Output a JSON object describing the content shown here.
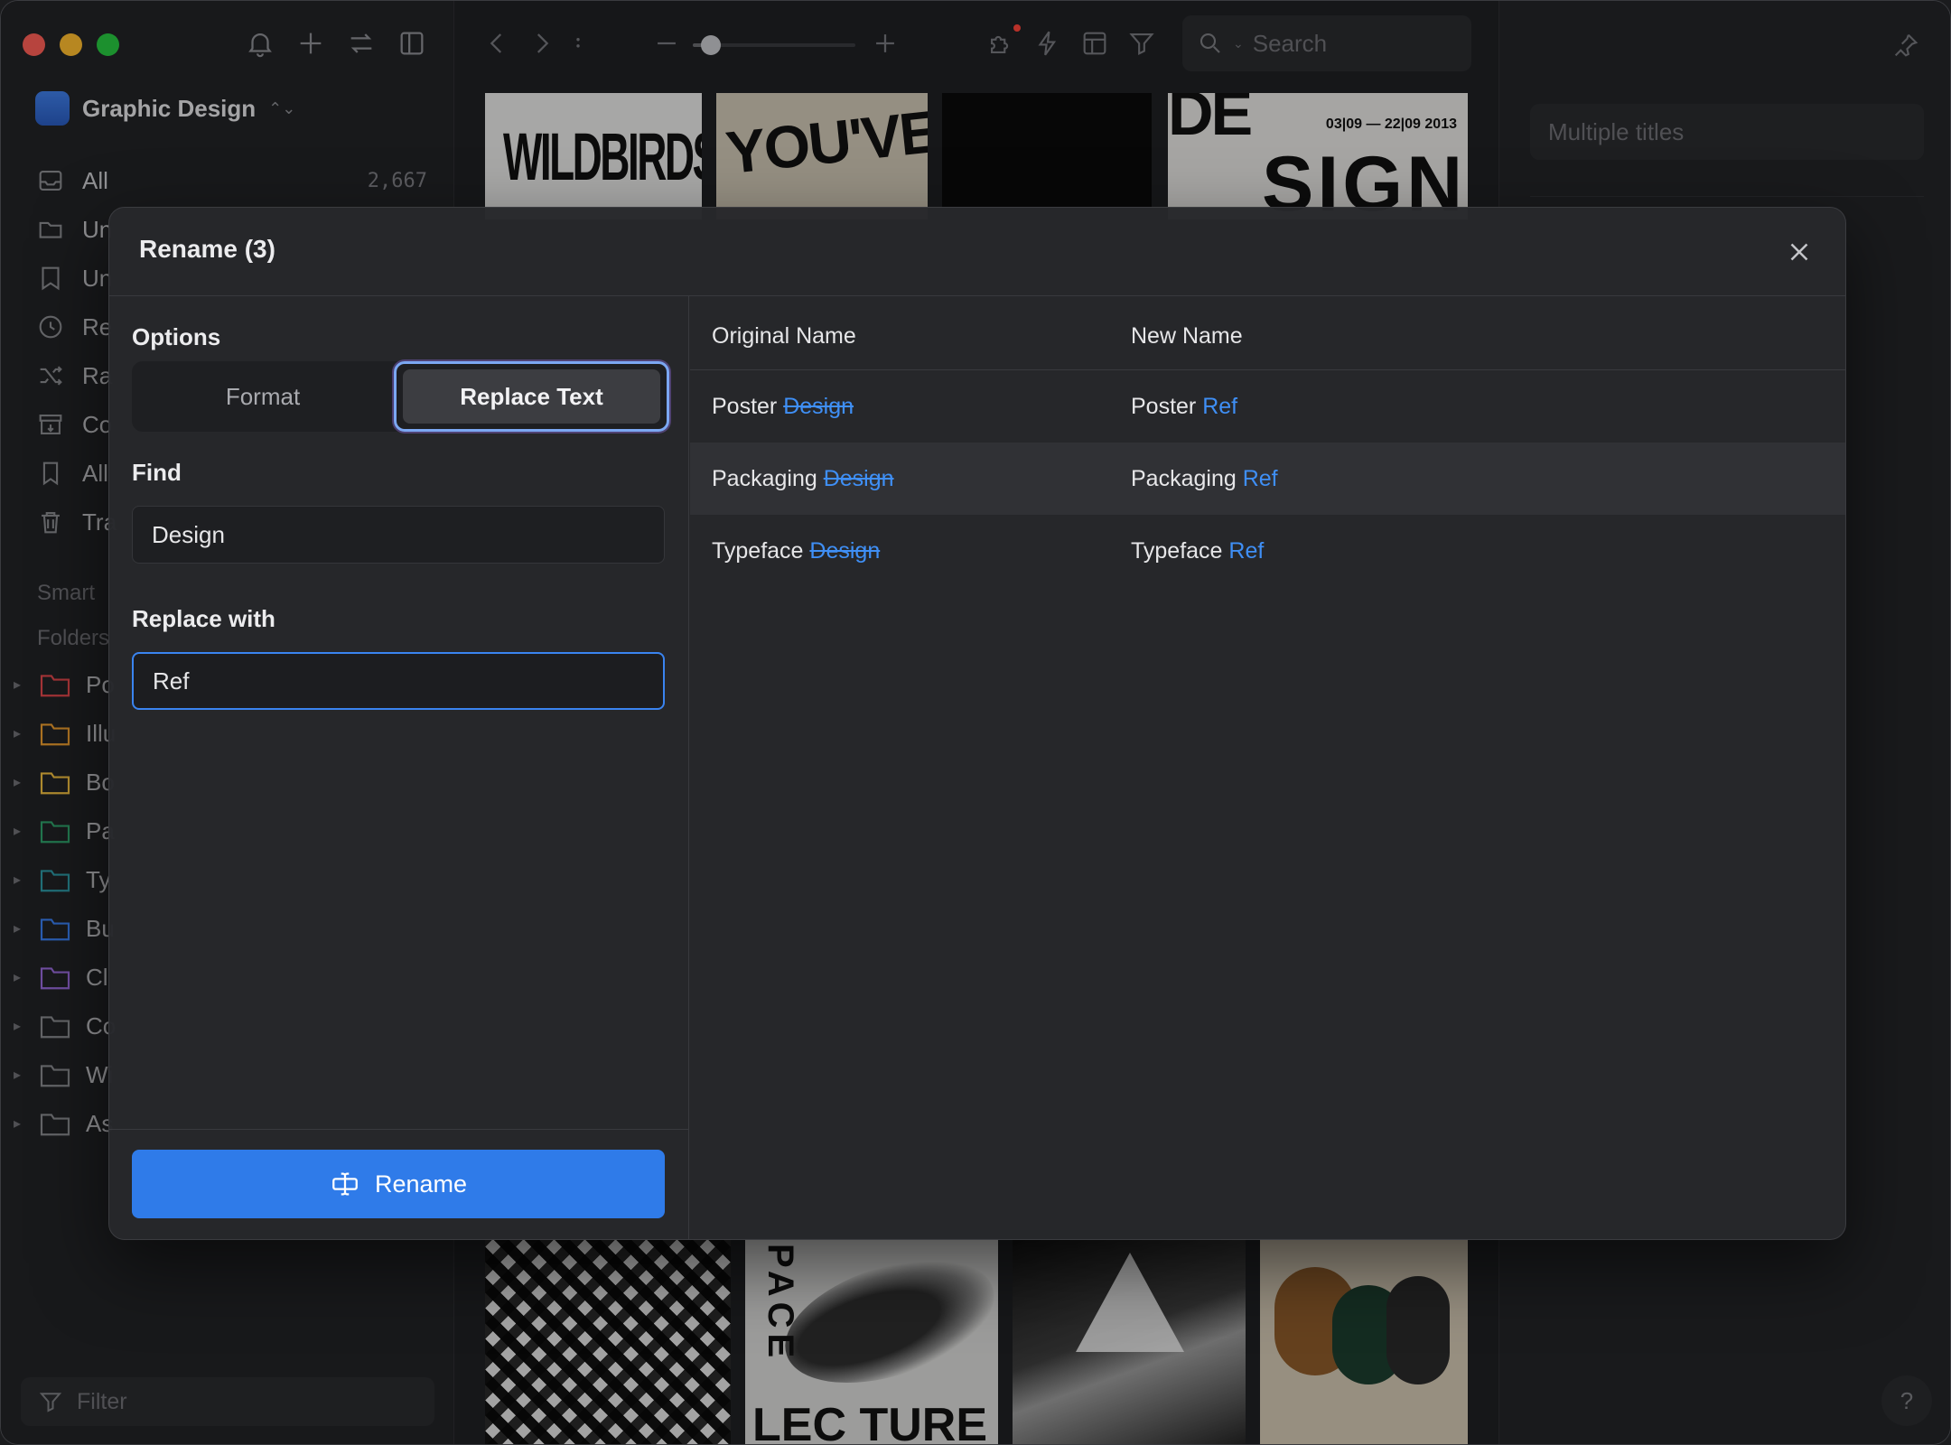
{
  "sidebar": {
    "library_name": "Graphic Design",
    "nav_items": [
      {
        "label": "All",
        "count": "2,667",
        "icon": "inbox-icon"
      },
      {
        "label": "Un",
        "icon": "unsorted-folder-icon"
      },
      {
        "label": "Un",
        "icon": "untagged-icon"
      },
      {
        "label": "Re",
        "icon": "recent-clock-icon"
      },
      {
        "label": "Ra",
        "icon": "random-shuffle-icon"
      },
      {
        "label": "Co",
        "icon": "archive-icon"
      },
      {
        "label": "All",
        "icon": "bookmark-icon"
      },
      {
        "label": "Tra",
        "icon": "trash-icon"
      }
    ],
    "section_smart": "Smart",
    "section_folders": "Folders",
    "folders": [
      {
        "label": "Po",
        "color": "#e5484d"
      },
      {
        "label": "Illu",
        "color": "#f0a030"
      },
      {
        "label": "Bo",
        "color": "#f5c242"
      },
      {
        "label": "Pa",
        "color": "#30a46c"
      },
      {
        "label": "Ty",
        "color": "#2f9ba8"
      },
      {
        "label": "Bu",
        "color": "#3b82f6"
      },
      {
        "label": "Cl",
        "color": "#9b6ddf"
      },
      {
        "label": "Co",
        "color": "#8b8c91"
      },
      {
        "label": "Wi",
        "color": "#8b8c91"
      },
      {
        "label": "As",
        "color": "#8b8c91"
      }
    ],
    "filter_placeholder": "Filter"
  },
  "toolbar": {
    "search_placeholder": "Search",
    "zoom_level": 0.11
  },
  "thumbnails": {
    "t1_text": "WILDBIRDS",
    "t2_text": "YOU'VE GOT",
    "t4_text_top": "DE",
    "t4_text_main": "SIGN",
    "t4_dates": "03|09 — 22|09    2013",
    "b2_text_vertical": "PACE",
    "b2_text": "LEC TURE"
  },
  "inspector": {
    "title_placeholder": "Multiple titles",
    "help_label": "?"
  },
  "modal": {
    "title": "Rename (3)",
    "options_label": "Options",
    "tabs": {
      "format": "Format",
      "replace": "Replace Text"
    },
    "find_label": "Find",
    "find_value": "Design",
    "replace_label": "Replace with",
    "replace_value": "Ref",
    "rename_button": "Rename",
    "columns": {
      "original": "Original Name",
      "new": "New Name"
    },
    "rows": [
      {
        "prefix": "Poster ",
        "find": "Design",
        "replace": "Ref"
      },
      {
        "prefix": "Packaging ",
        "find": "Design",
        "replace": "Ref"
      },
      {
        "prefix": "Typeface ",
        "find": "Design",
        "replace": "Ref"
      }
    ]
  },
  "colors": {
    "accent": "#2f7be9",
    "highlight_text": "#3f8ff5"
  }
}
